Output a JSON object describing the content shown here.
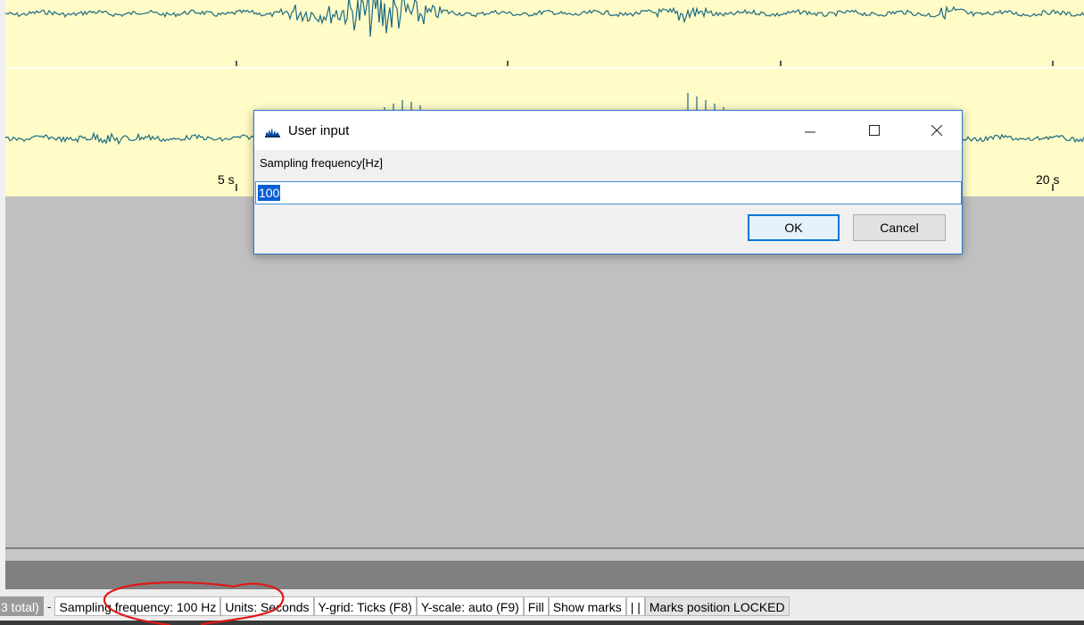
{
  "waveform": {
    "tick_labels": [
      "5 s",
      "20 s"
    ],
    "colors": {
      "background": "#fffcc7",
      "trace": "#1d6a80"
    }
  },
  "dialog": {
    "title": "User input",
    "field_label": "Sampling frequency[Hz]",
    "input_value": "100",
    "ok_label": "OK",
    "cancel_label": "Cancel",
    "icons": [
      "app-icon",
      "minimize-icon",
      "maximize-icon",
      "close-icon"
    ]
  },
  "status_bar": {
    "total_text": "3 total)",
    "separator": "-",
    "items": [
      "Sampling frequency: 100 Hz",
      "Units: Seconds",
      "Y-grid:  Ticks (F8)",
      "Y-scale: auto (F9)",
      "Fill",
      "Show marks",
      "| |",
      "Marks position LOCKED"
    ]
  },
  "annotation": {
    "color": "#e01919",
    "shape": "freehand-circle"
  }
}
